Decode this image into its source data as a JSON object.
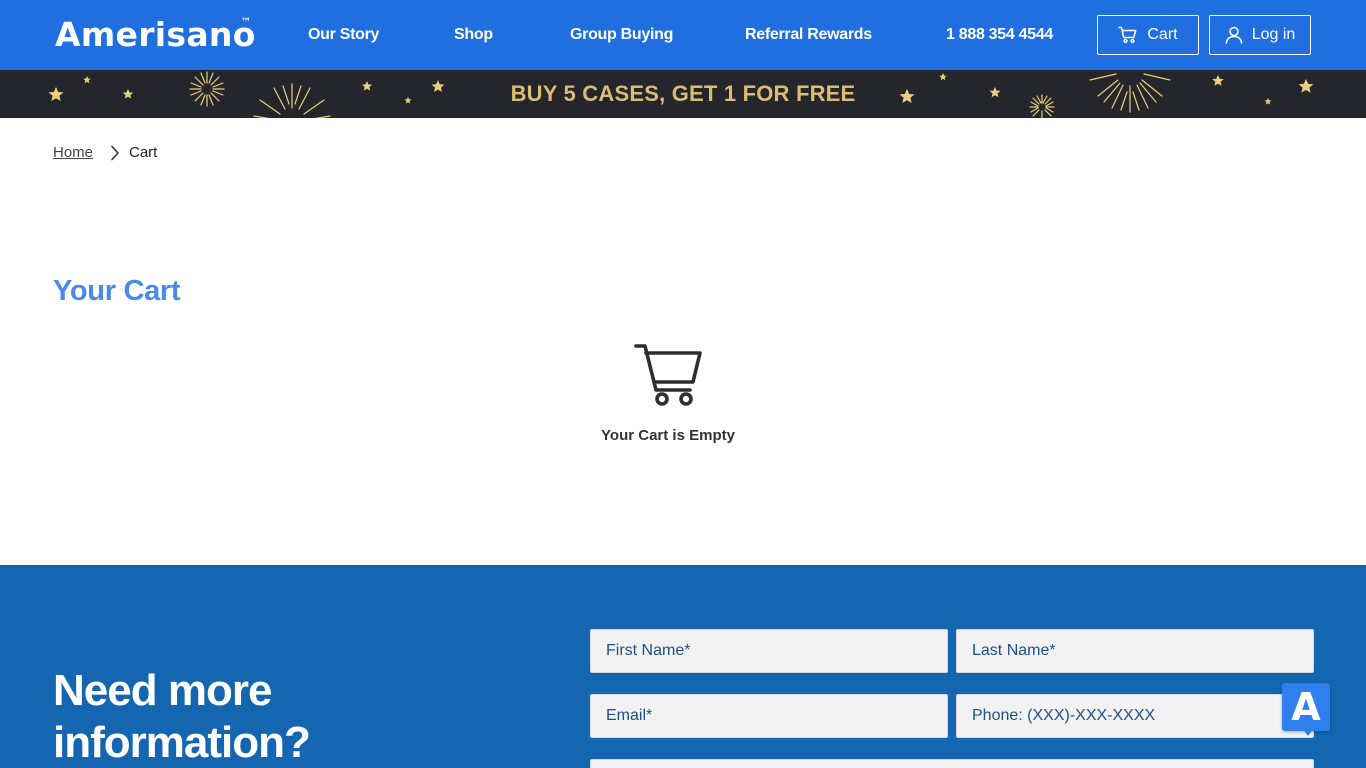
{
  "header": {
    "logo": "Amerisano",
    "logo_mark": "™",
    "nav": [
      {
        "label": "Our Story"
      },
      {
        "label": "Shop"
      },
      {
        "label": "Group Buying"
      },
      {
        "label": "Referral Rewards"
      }
    ],
    "phone": "1 888 354 4544",
    "cart_label": "Cart",
    "login_label": "Log in",
    "icons": {
      "cart": "cart-icon",
      "user": "user-icon"
    }
  },
  "banner": {
    "text": "BUY 5 CASES, GET 1 FOR FREE",
    "text_color": "#d8bd72",
    "background": "#24262b"
  },
  "breadcrumb": {
    "home": "Home",
    "current": "Cart"
  },
  "cart": {
    "title": "Your Cart",
    "empty_message": "Your Cart is Empty",
    "empty_icon": "shopping-cart-icon"
  },
  "contact": {
    "heading": "Need more information?",
    "fields": {
      "first_name": "First Name*",
      "last_name": "Last Name*",
      "email": "Email*",
      "phone": "Phone: (XXX)-XXX-XXXX"
    }
  },
  "widget": {
    "label": "A"
  },
  "colors": {
    "brand_blue": "#1f6fe0",
    "section_blue": "#1466b0",
    "title_blue": "#4a8ae8",
    "gold": "#d8bd72"
  }
}
